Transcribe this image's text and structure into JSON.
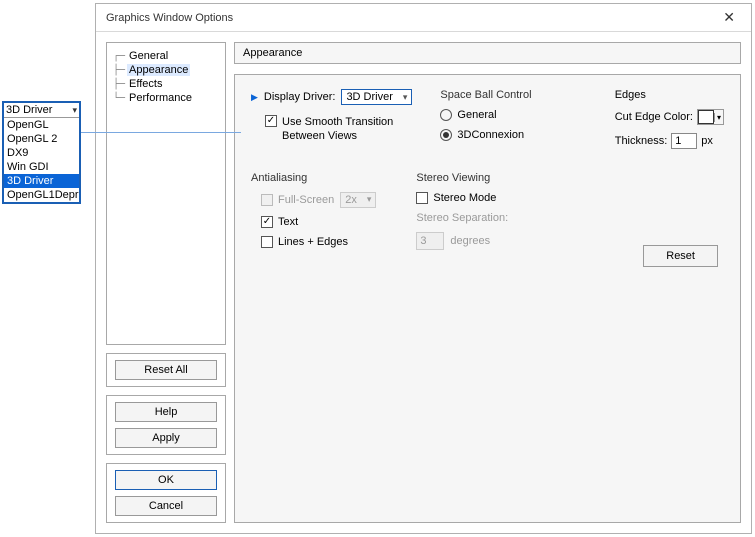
{
  "popup": {
    "selected": "3D Driver",
    "options": [
      "OpenGL",
      "OpenGL 2",
      "DX9",
      "Win GDI",
      "3D Driver",
      "OpenGL1Depr"
    ],
    "highlight_index": 4
  },
  "dialog": {
    "title": "Graphics Window Options",
    "close": "✕"
  },
  "tree": {
    "items": [
      "General",
      "Appearance",
      "Effects",
      "Performance"
    ],
    "selected_index": 1
  },
  "buttons": {
    "reset_all": "Reset All",
    "help": "Help",
    "apply": "Apply",
    "ok": "OK",
    "cancel": "Cancel"
  },
  "pane": {
    "heading": "Appearance",
    "display_driver_label": "Display Driver:",
    "display_driver_value": "3D Driver",
    "smooth_label": "Use Smooth Transition\nBetween Views",
    "space_ball": {
      "title": "Space Ball Control",
      "opt1": "General",
      "opt2": "3DConnexion"
    },
    "edges": {
      "title": "Edges",
      "cut_label": "Cut Edge Color:",
      "thickness_label": "Thickness:",
      "thickness_value": "1",
      "thickness_unit": "px"
    },
    "aa": {
      "title": "Antialiasing",
      "full": "Full-Screen",
      "full_value": "2x",
      "text": "Text",
      "lines": "Lines + Edges"
    },
    "stereo": {
      "title": "Stereo Viewing",
      "mode": "Stereo Mode",
      "sep_label": "Stereo Separation:",
      "sep_value": "3",
      "sep_unit": "degrees"
    },
    "reset": "Reset"
  }
}
